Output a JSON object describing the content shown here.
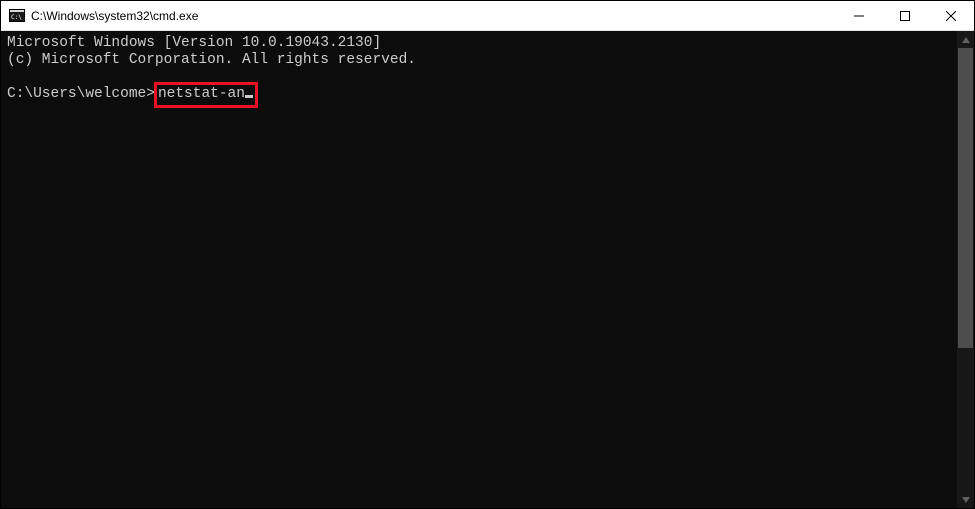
{
  "titlebar": {
    "path": "C:\\Windows\\system32\\cmd.exe"
  },
  "terminal": {
    "banner_line1": "Microsoft Windows [Version 10.0.19043.2130]",
    "banner_line2": "(c) Microsoft Corporation. All rights reserved.",
    "prompt": "C:\\Users\\welcome>",
    "command": "netstat-an"
  }
}
